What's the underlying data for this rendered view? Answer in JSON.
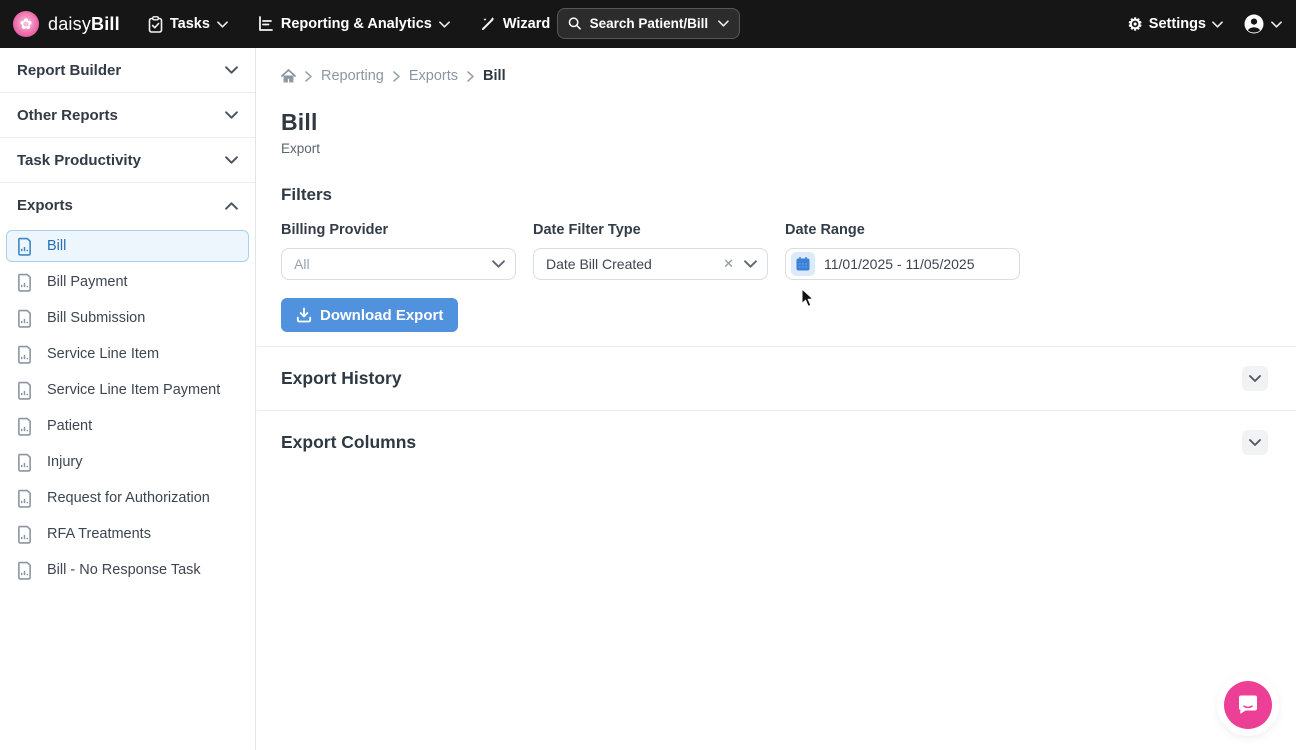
{
  "navbar": {
    "brand_regular": "daisy",
    "brand_bold": "Bill",
    "tasks_label": "Tasks",
    "reporting_label": "Reporting & Analytics",
    "wizard_label": "Wizard",
    "search_label": "Search Patient/Bill",
    "settings_label": "Settings"
  },
  "sidebar": {
    "sections": [
      {
        "label": "Report Builder",
        "expanded": false
      },
      {
        "label": "Other Reports",
        "expanded": false
      },
      {
        "label": "Task Productivity",
        "expanded": false
      },
      {
        "label": "Exports",
        "expanded": true
      }
    ],
    "export_items": [
      {
        "label": "Bill",
        "selected": true
      },
      {
        "label": "Bill Payment",
        "selected": false
      },
      {
        "label": "Bill Submission",
        "selected": false
      },
      {
        "label": "Service Line Item",
        "selected": false
      },
      {
        "label": "Service Line Item Payment",
        "selected": false
      },
      {
        "label": "Patient",
        "selected": false
      },
      {
        "label": "Injury",
        "selected": false
      },
      {
        "label": "Request for Authorization",
        "selected": false
      },
      {
        "label": "RFA Treatments",
        "selected": false
      },
      {
        "label": "Bill - No Response Task",
        "selected": false
      }
    ]
  },
  "breadcrumb": {
    "items": [
      "Reporting",
      "Exports"
    ],
    "current": "Bill"
  },
  "page": {
    "title": "Bill",
    "subtitle": "Export"
  },
  "filters": {
    "heading": "Filters",
    "billing_provider_label": "Billing Provider",
    "billing_provider_value": "All",
    "date_filter_type_label": "Date Filter Type",
    "date_filter_type_value": "Date Bill Created",
    "date_range_label": "Date Range",
    "date_range_value": "11/01/2025 - 11/05/2025",
    "download_button_label": "Download Export"
  },
  "panels": [
    {
      "title": "Export History"
    },
    {
      "title": "Export Columns"
    }
  ],
  "colors": {
    "navbar_bg": "#161616",
    "accent_blue": "#5192df",
    "brand_pink": "#ec3f95",
    "selected_item_bg": "#edf6fd",
    "selected_item_border": "#abd0ee",
    "selected_item_text": "#2470b3"
  }
}
